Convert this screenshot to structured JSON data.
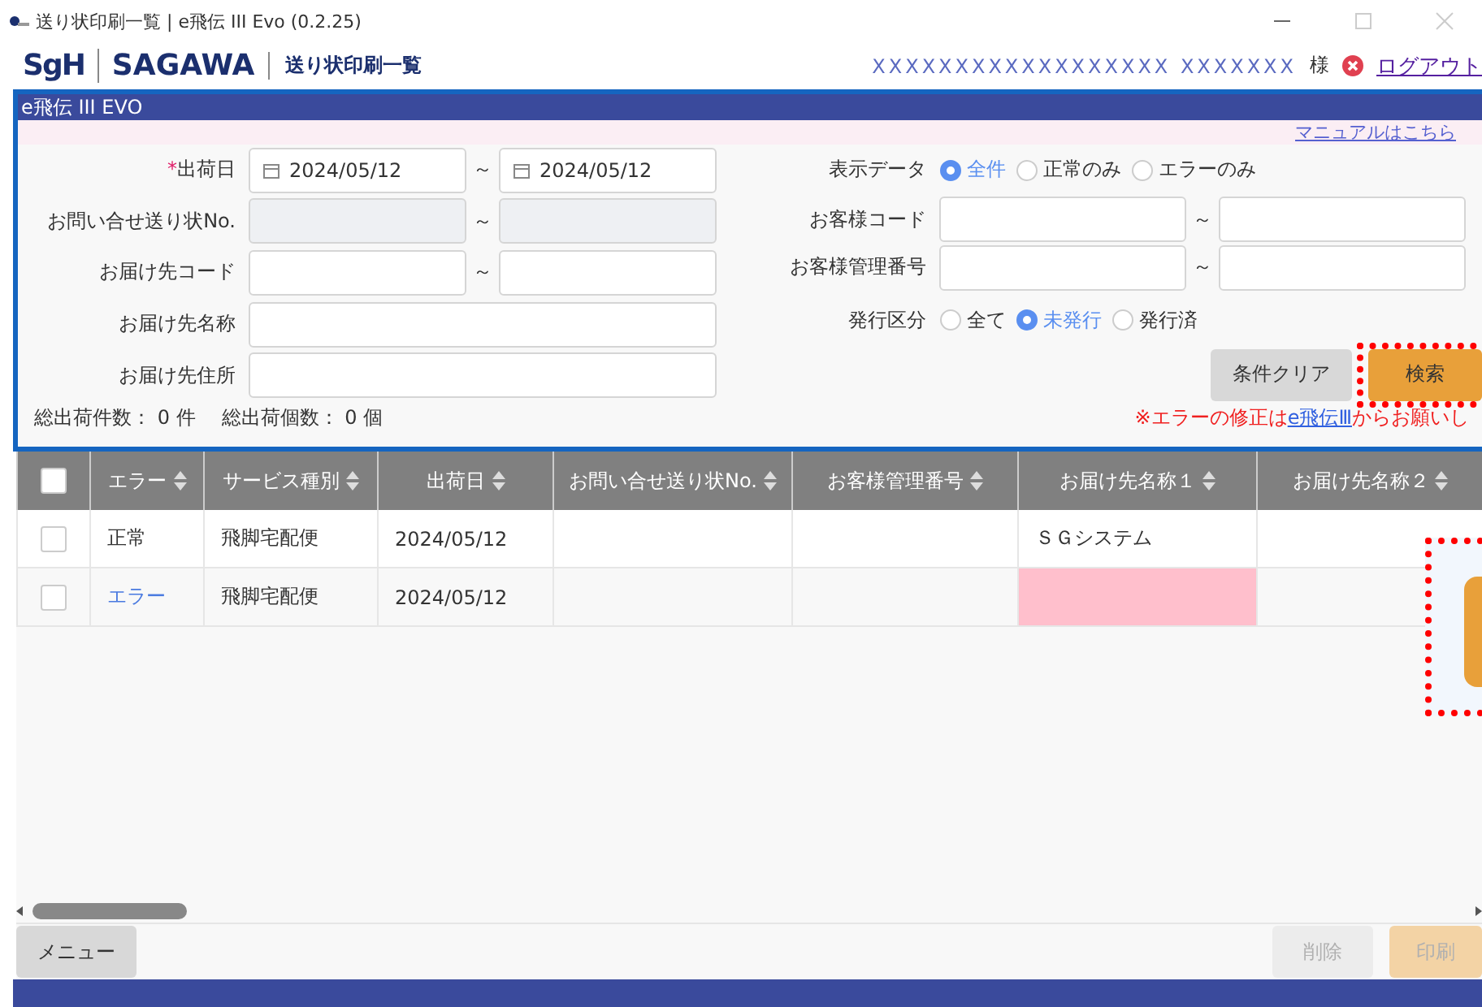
{
  "window": {
    "title": "送り状印刷一覧 | e飛伝 III Evo (0.2.25)"
  },
  "header": {
    "logo": "SgH",
    "brand": "SAGAWA",
    "page_title": "送り状印刷一覧",
    "user": "XXXXXXXXXXXXXXXXXX XXXXXXX",
    "honorific": "様",
    "logout": "ログアウト"
  },
  "panel": {
    "title": "e飛伝 III EVO",
    "manual_link": "マニュアルはこちら"
  },
  "form_left": [
    {
      "label": "出荷日",
      "mark": "*",
      "kind": "date_range",
      "from": "2024/05/12",
      "to": "2024/05/12",
      "separator": "～"
    },
    {
      "label": "お問い合せ送り状No.",
      "kind": "range",
      "disabled": true,
      "separator": "～"
    },
    {
      "label": "お届け先コード",
      "kind": "range",
      "disabled": false,
      "separator": "～"
    },
    {
      "label": "お届け先名称",
      "kind": "single"
    },
    {
      "label": "お届け先住所",
      "kind": "single"
    }
  ],
  "form_right": [
    {
      "label": "表示データ",
      "kind": "radio",
      "options": [
        {
          "label": "全件",
          "selected": true
        },
        {
          "label": "正常のみ",
          "selected": false
        },
        {
          "label": "エラーのみ",
          "selected": false
        }
      ]
    },
    {
      "label": "お客様コード",
      "kind": "range",
      "disabled": false,
      "separator": "～"
    },
    {
      "label": "お客様管理番号",
      "kind": "range",
      "disabled": false,
      "separator": "～"
    },
    {
      "label": "発行区分",
      "kind": "radio",
      "options": [
        {
          "label": "全て",
          "selected": false
        },
        {
          "label": "未発行",
          "selected": true
        },
        {
          "label": "発行済",
          "selected": false
        }
      ]
    }
  ],
  "buttons": [
    {
      "label": "条件クリア",
      "kind": "secondary",
      "highlighted": false
    },
    {
      "label": "検索",
      "kind": "primary",
      "highlighted": true
    }
  ],
  "totals": [
    "総出荷件数：  0 件",
    "総出荷個数：  0 個"
  ],
  "error_note": {
    "before": "※エラーの修正は",
    "link": "e飛伝Ⅲ",
    "after": "からお願いし"
  },
  "table": {
    "select_all": {
      "checked": false
    },
    "columns": [
      "エラー",
      "サービス種別",
      "出荷日",
      "お問い合せ送り状No.",
      "お客様管理番号",
      "お届け先名称１",
      "お届け先名称２"
    ],
    "rows": [
      {
        "checked": false,
        "cells": [
          {
            "text": "正常",
            "kind": "ok"
          },
          {
            "text": "飛脚宅配便"
          },
          {
            "text": "2024/05/12"
          },
          {},
          {},
          {
            "text": "ＳＧシステム"
          },
          {}
        ]
      },
      {
        "checked": false,
        "cells": [
          {
            "text": "エラー",
            "kind": "error"
          },
          {
            "text": "飛脚宅配便"
          },
          {
            "text": "2024/05/12"
          },
          {},
          {},
          {
            "error": true
          },
          {}
        ]
      }
    ]
  },
  "side_callout": {
    "highlighted": true
  },
  "footer": {
    "menu": "メニュー",
    "actions": [
      {
        "label": "削除",
        "kind": "delete",
        "disabled": true
      },
      {
        "label": "印刷",
        "kind": "print",
        "disabled": true
      }
    ]
  }
}
